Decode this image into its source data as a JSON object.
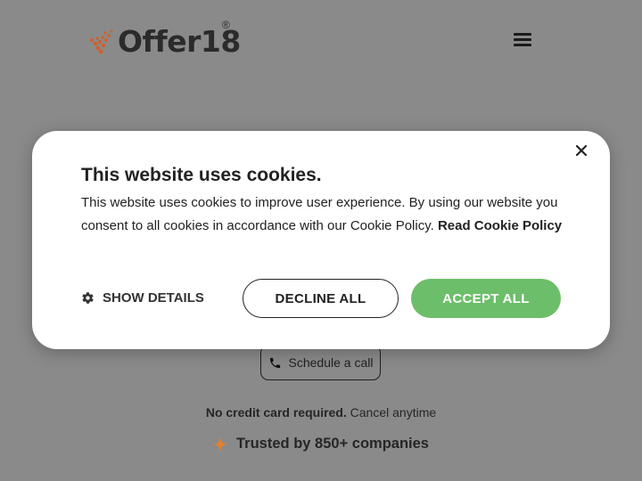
{
  "header": {
    "logo_text": "Offer18",
    "logo_registered": "®",
    "menu_icon": "hamburger-menu-icon"
  },
  "hero": {
    "schedule_label": "Schedule a call",
    "schedule_icon": "phone-icon",
    "no_card_bold": "No credit card required.",
    "no_card_rest": " Cancel anytime",
    "trusted_label": "Trusted by 850+ companies",
    "trusted_icon": "sparkle-icon"
  },
  "cookie_banner": {
    "title": "This website uses cookies.",
    "body": "This website uses cookies to improve user experience. By using our website you consent to all cookies in accordance with our Cookie Policy. ",
    "read_policy_link": "Read Cookie Policy",
    "show_details_label": "SHOW DETAILS",
    "decline_label": "DECLINE ALL",
    "accept_label": "ACCEPT ALL",
    "close_icon": "close-icon"
  },
  "colors": {
    "overlay_bg": "#8a8a8a",
    "accept_green": "#6dbe6a",
    "logo_orange": "#d0602a",
    "sparkle_orange": "#e0822e"
  }
}
